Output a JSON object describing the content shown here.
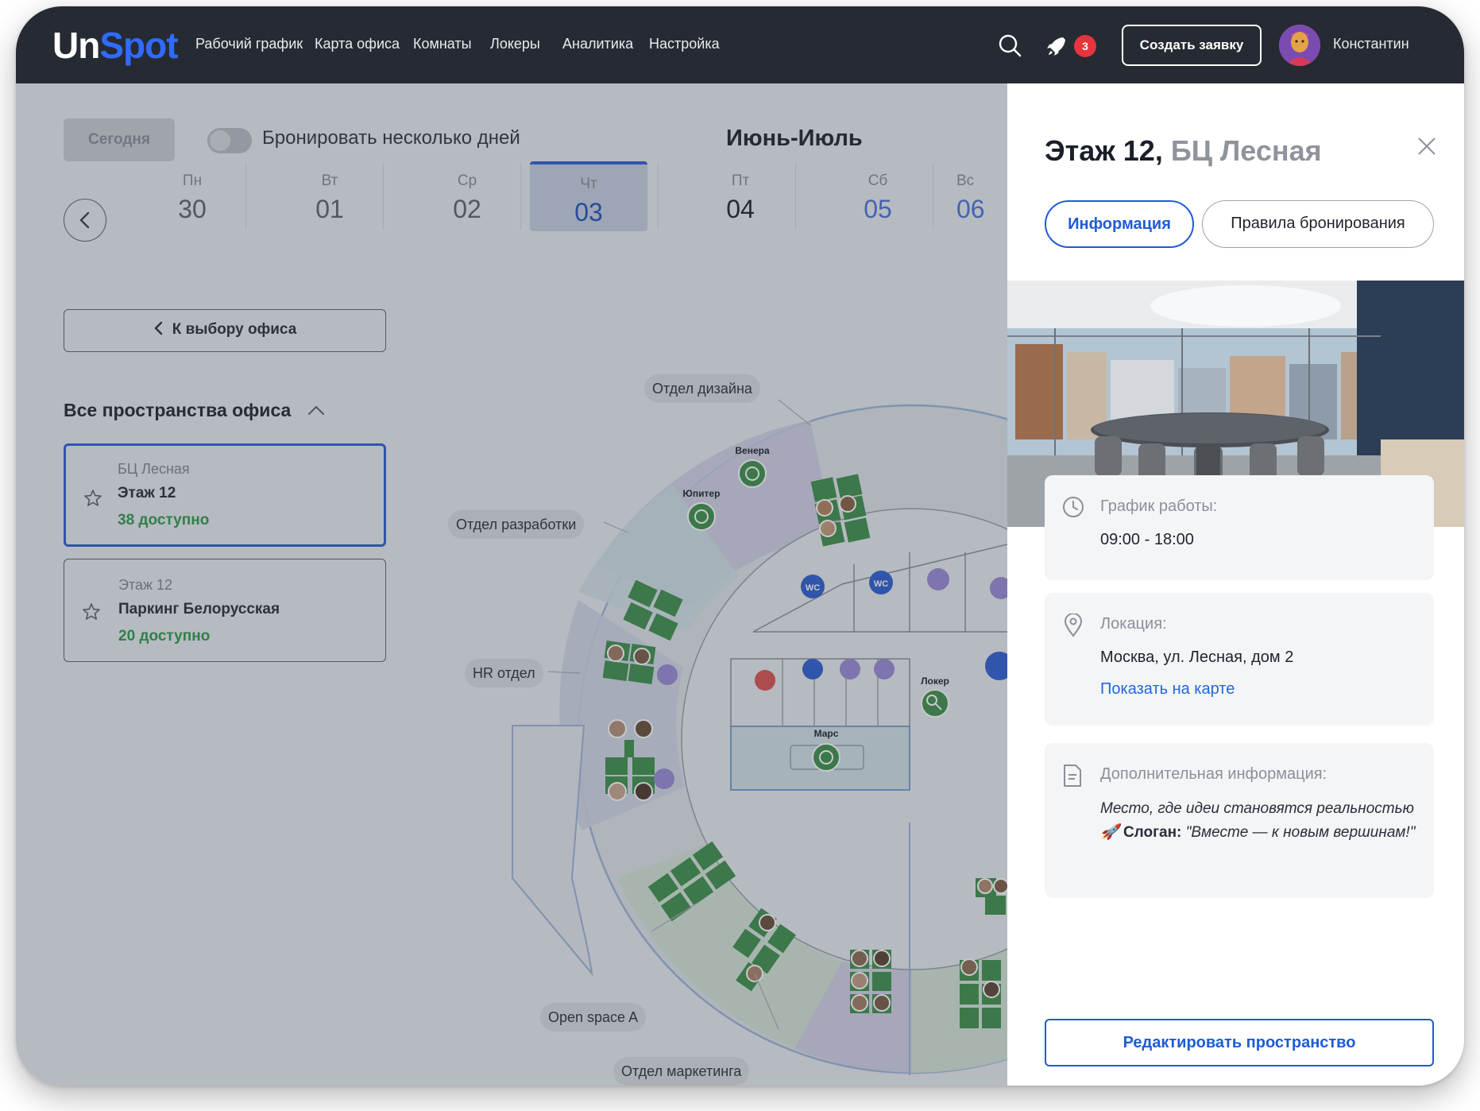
{
  "app": {
    "logo_part1": "Un",
    "logo_part2": "Spot"
  },
  "nav": {
    "items": [
      "Рабочий график",
      "Карта офиса",
      "Комнаты",
      "Локеры",
      "Аналитика",
      "Настройка"
    ]
  },
  "header": {
    "notification_count": "3",
    "create_button": "Создать заявку",
    "user_name": "Константин"
  },
  "toolbar": {
    "today_button": "Сегодня",
    "multi_day_label": "Бронировать несколько дней",
    "month_title": "Июнь-Июль"
  },
  "days": [
    {
      "weekday": "Пн",
      "date": "30"
    },
    {
      "weekday": "Вт",
      "date": "01"
    },
    {
      "weekday": "Ср",
      "date": "02"
    },
    {
      "weekday": "Чт",
      "date": "03"
    },
    {
      "weekday": "Пт",
      "date": "04"
    },
    {
      "weekday": "Сб",
      "date": "05"
    },
    {
      "weekday": "Вс",
      "date": "06"
    }
  ],
  "sidebar": {
    "back_button": "К выбору офиса",
    "spaces_title": "Все пространства офиса",
    "cards": [
      {
        "line1": "БЦ Лесная",
        "line2": "Этаж 12",
        "line3": "38 доступно"
      },
      {
        "line1": "Этаж 12",
        "line2": "Паркинг Белорусская",
        "line3": "20 доступно"
      }
    ]
  },
  "map": {
    "zone_labels": {
      "design": "Отдел дизайна",
      "dev": "Отдел разработки",
      "hr": "HR отдел",
      "openspace": "Open space A",
      "marketing": "Отдел маркетинга"
    },
    "room_labels": {
      "venera": "Венера",
      "jupiter": "Юпитер",
      "mars": "Марс",
      "locker": "Локер"
    },
    "wc": "WC"
  },
  "panel": {
    "title": "Этаж 12,",
    "title_sub": "БЦ Лесная",
    "tab_info": "Информация",
    "tab_rules": "Правила бронирования",
    "schedule_label": "График работы:",
    "schedule_value": "09:00 - 18:00",
    "location_label": "Локация:",
    "location_value": "Москва, ул. Лесная, дом 2",
    "location_link": "Показать на карте",
    "extra_label": "Дополнительная информация:",
    "extra_text": "Место, где идеи становятся реальностью",
    "slogan_emoji": "🚀",
    "slogan_label": "Слоган:",
    "slogan_text": "\"Вместе — к новым вершинам!\"",
    "edit_button": "Редактировать пространство"
  },
  "colors": {
    "accent": "#1f5bd6",
    "topbar": "#262a33",
    "available": "#2e9a4a",
    "badge": "#e8343c"
  }
}
